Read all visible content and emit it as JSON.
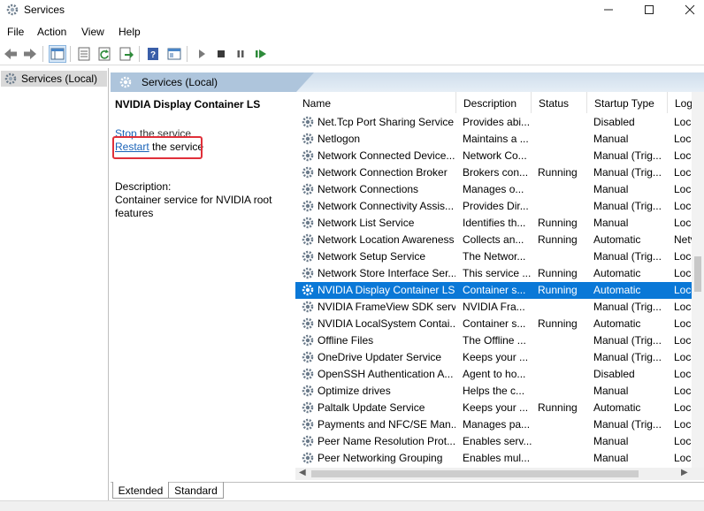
{
  "window": {
    "title": "Services"
  },
  "menu": [
    "File",
    "Action",
    "View",
    "Help"
  ],
  "tree": {
    "item": "Services (Local)"
  },
  "header": {
    "title": "Services (Local)"
  },
  "extended": {
    "service_name": "NVIDIA Display Container LS",
    "stop_link": "Stop",
    "stop_rest": " the service",
    "restart_link": "Restart",
    "restart_rest": " the service",
    "description_label": "Description:",
    "description": "Container service for NVIDIA root features"
  },
  "columns": [
    "Name",
    "Description",
    "Status",
    "Startup Type",
    "Log"
  ],
  "rows": [
    {
      "name": "Net.Tcp Port Sharing Service",
      "desc": "Provides abi...",
      "status": "",
      "startup": "Disabled",
      "log": "Loca"
    },
    {
      "name": "Netlogon",
      "desc": "Maintains a ...",
      "status": "",
      "startup": "Manual",
      "log": "Loca"
    },
    {
      "name": "Network Connected Device...",
      "desc": "Network Co...",
      "status": "",
      "startup": "Manual (Trig...",
      "log": "Loca"
    },
    {
      "name": "Network Connection Broker",
      "desc": "Brokers con...",
      "status": "Running",
      "startup": "Manual (Trig...",
      "log": "Loca"
    },
    {
      "name": "Network Connections",
      "desc": "Manages o...",
      "status": "",
      "startup": "Manual",
      "log": "Loca"
    },
    {
      "name": "Network Connectivity Assis...",
      "desc": "Provides Dir...",
      "status": "",
      "startup": "Manual (Trig...",
      "log": "Loca"
    },
    {
      "name": "Network List Service",
      "desc": "Identifies th...",
      "status": "Running",
      "startup": "Manual",
      "log": "Loca"
    },
    {
      "name": "Network Location Awareness",
      "desc": "Collects an...",
      "status": "Running",
      "startup": "Automatic",
      "log": "Netv"
    },
    {
      "name": "Network Setup Service",
      "desc": "The Networ...",
      "status": "",
      "startup": "Manual (Trig...",
      "log": "Loca"
    },
    {
      "name": "Network Store Interface Ser...",
      "desc": "This service ...",
      "status": "Running",
      "startup": "Automatic",
      "log": "Loca"
    },
    {
      "name": "NVIDIA Display Container LS",
      "desc": "Container s...",
      "status": "Running",
      "startup": "Automatic",
      "log": "Loca"
    },
    {
      "name": "NVIDIA FrameView SDK serv...",
      "desc": "NVIDIA Fra...",
      "status": "",
      "startup": "Manual (Trig...",
      "log": "Loca"
    },
    {
      "name": "NVIDIA LocalSystem Contai...",
      "desc": "Container s...",
      "status": "Running",
      "startup": "Automatic",
      "log": "Loca"
    },
    {
      "name": "Offline Files",
      "desc": "The Offline ...",
      "status": "",
      "startup": "Manual (Trig...",
      "log": "Loca"
    },
    {
      "name": "OneDrive Updater Service",
      "desc": "Keeps your ...",
      "status": "",
      "startup": "Manual (Trig...",
      "log": "Loca"
    },
    {
      "name": "OpenSSH Authentication A...",
      "desc": "Agent to ho...",
      "status": "",
      "startup": "Disabled",
      "log": "Loca"
    },
    {
      "name": "Optimize drives",
      "desc": "Helps the c...",
      "status": "",
      "startup": "Manual",
      "log": "Loca"
    },
    {
      "name": "Paltalk Update Service",
      "desc": "Keeps your ...",
      "status": "Running",
      "startup": "Automatic",
      "log": "Loca"
    },
    {
      "name": "Payments and NFC/SE Man...",
      "desc": "Manages pa...",
      "status": "",
      "startup": "Manual (Trig...",
      "log": "Loca"
    },
    {
      "name": "Peer Name Resolution Prot...",
      "desc": "Enables serv...",
      "status": "",
      "startup": "Manual",
      "log": "Loca"
    },
    {
      "name": "Peer Networking Grouping",
      "desc": "Enables mul...",
      "status": "",
      "startup": "Manual",
      "log": "Loca"
    }
  ],
  "selected_index": 10,
  "tabs": [
    "Extended",
    "Standard"
  ],
  "colors": {
    "selection": "#0a78d7",
    "link": "#1a63b8",
    "highlight_box": "#e0303a",
    "header_band": "#aec5dc"
  }
}
